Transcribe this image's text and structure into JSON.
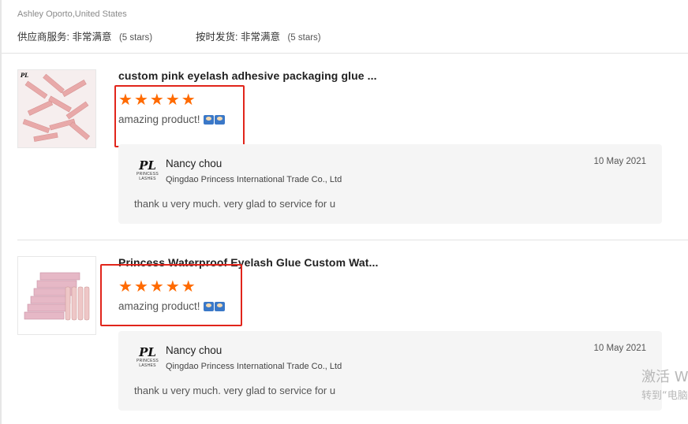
{
  "reviewer": "Ashley Oporto,United States",
  "summary": {
    "supplier_label": "供应商服务:",
    "supplier_value": "非常满意",
    "supplier_note": "(5 stars)",
    "shipping_label": "按时发货:",
    "shipping_value": "非常满意",
    "shipping_note": "(5 stars)"
  },
  "reviews": [
    {
      "product_title": "custom pink eyelash adhesive packaging glue ...",
      "rating": 5,
      "comment": "amazing product!",
      "reply": {
        "seller_logo_text": "PL",
        "seller_logo_sub": "PRINCESS LASHES",
        "seller_name": "Nancy chou",
        "company": "Qingdao Princess International Trade Co., Ltd",
        "date": "10 May 2021",
        "text": "thank u very much.  very glad to service for u"
      }
    },
    {
      "product_title": "Princess Waterproof Eyelash Glue Custom Wat...",
      "rating": 5,
      "comment": "amazing product!",
      "reply": {
        "seller_logo_text": "PL",
        "seller_logo_sub": "PRINCESS LASHES",
        "seller_name": "Nancy chou",
        "company": "Qingdao Princess International Trade Co., Ltd",
        "date": "10 May 2021",
        "text": "thank u very much.  very glad to service for u"
      }
    }
  ],
  "watermark": {
    "line1": "激活 W",
    "line2": "转到“电脑"
  },
  "colors": {
    "star": "#ff6a00",
    "highlight_box": "#e1251b",
    "reply_bg": "#f5f5f5"
  }
}
